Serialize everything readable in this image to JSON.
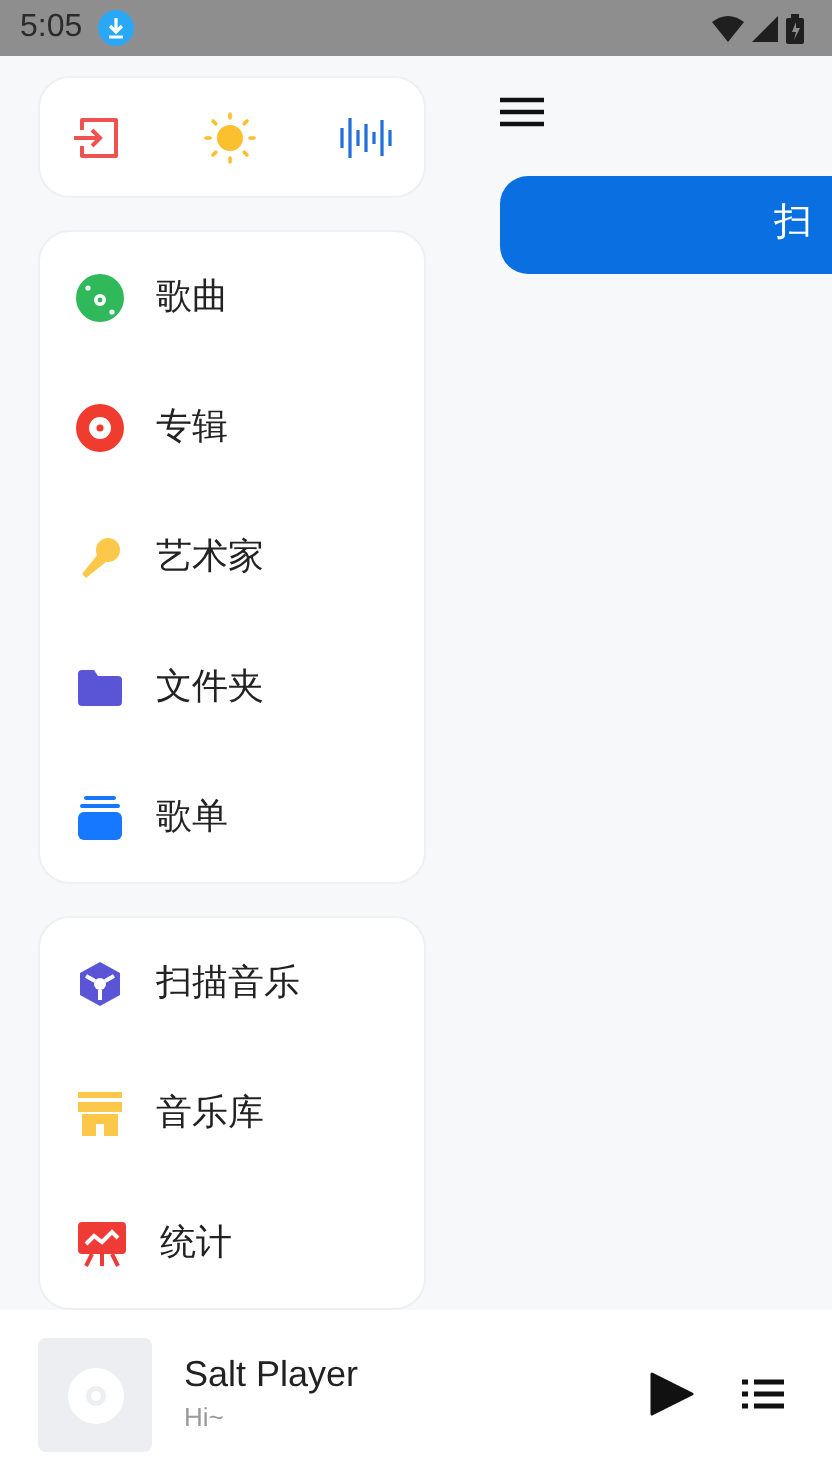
{
  "status_bar": {
    "time": "5:05"
  },
  "quick_actions": [
    {
      "kind": "exit"
    },
    {
      "kind": "theme"
    },
    {
      "kind": "equalizer"
    }
  ],
  "library_menu": [
    {
      "kind": "songs",
      "label": "歌曲"
    },
    {
      "kind": "albums",
      "label": "专辑"
    },
    {
      "kind": "artists",
      "label": "艺术家"
    },
    {
      "kind": "folders",
      "label": "文件夹"
    },
    {
      "kind": "playlists",
      "label": "歌单"
    }
  ],
  "tools_menu": [
    {
      "kind": "scan",
      "label": "扫描音乐"
    },
    {
      "kind": "library",
      "label": "音乐库"
    },
    {
      "kind": "stats",
      "label": "统计"
    }
  ],
  "main": {
    "action_button": "扫"
  },
  "now_playing": {
    "title": "Salt Player",
    "subtitle": "Hi~"
  }
}
